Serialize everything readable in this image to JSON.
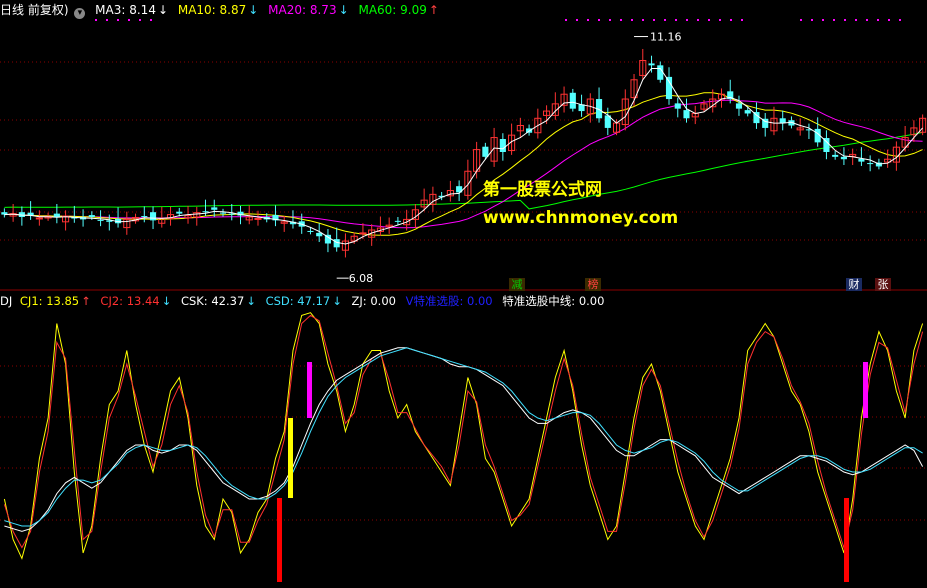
{
  "main_header": {
    "prefix": "日线 前复权)",
    "ma3": {
      "label": "MA3:",
      "value": "8.14",
      "arrow": "↓",
      "color": "#ffffff"
    },
    "ma10": {
      "label": "MA10:",
      "value": "8.87",
      "arrow": "↓",
      "color": "#ffff00"
    },
    "ma20": {
      "label": "MA20:",
      "value": "8.73",
      "arrow": "↓",
      "color": "#ff00ff"
    },
    "ma60": {
      "label": "MA60:",
      "value": "9.09",
      "arrow": "↑",
      "color": "#00ff00"
    }
  },
  "price_labels": {
    "high": "11.16",
    "low": "6.08"
  },
  "event_markers": [
    {
      "text": "减",
      "color": "#00cc00",
      "bg": "#3a2a00"
    },
    {
      "text": "榜",
      "color": "#ff4040",
      "bg": "#3a2a00"
    },
    {
      "text": "财",
      "color": "#ffffff",
      "bg": "#1a2a60"
    },
    {
      "text": "张",
      "color": "#ffffff",
      "bg": "#5a1010"
    }
  ],
  "watermark": {
    "line1": "第一股票公式网",
    "line2": "www.chnmoney.com"
  },
  "indicator_header": {
    "prefix": "DJ",
    "cj1": {
      "label": "CJ1:",
      "value": "13.85",
      "arrow": "↑",
      "color": "#ffff00"
    },
    "cj2": {
      "label": "CJ2:",
      "value": "13.44",
      "arrow": "↓",
      "color": "#ff3030"
    },
    "csk": {
      "label": "CSK:",
      "value": "42.37",
      "arrow": "↓",
      "color": "#ffffff"
    },
    "csd": {
      "label": "CSD:",
      "value": "47.17",
      "arrow": "↓",
      "color": "#40e0ff"
    },
    "zj": {
      "label": "ZJ:",
      "value": "0.00",
      "color": "#ffffff"
    },
    "v_select": {
      "label": "V特准选股:",
      "value": "0.00",
      "color": "#2020ff"
    },
    "mid_select": {
      "label": "特准选股中线:",
      "value": "0.00",
      "color": "#ffffff"
    }
  },
  "colors": {
    "background": "#000000",
    "grid": "#8b0000",
    "candle_up": "#ff3333",
    "candle_down": "#54ffff",
    "ma3": "#ffffff",
    "ma10": "#ffff00",
    "ma20": "#ff00ff",
    "ma60": "#00ff00",
    "cj1": "#ffff00",
    "cj2": "#ff3030",
    "csk": "#ffffff",
    "csd": "#40e0ff",
    "signal_red": "#ff0000",
    "signal_yellow": "#ffff00",
    "signal_magenta": "#ff00ff"
  },
  "chart_data": [
    {
      "type": "candlestick",
      "title": "日线 前复权",
      "price_range": [
        6.08,
        11.16
      ],
      "marked_high": 11.16,
      "marked_low": 6.08,
      "close_series": [
        7.4,
        7.42,
        7.35,
        7.38,
        7.33,
        7.36,
        7.34,
        7.37,
        7.32,
        7.3,
        7.35,
        7.28,
        7.25,
        7.22,
        7.3,
        7.34,
        7.36,
        7.28,
        7.32,
        7.4,
        7.42,
        7.38,
        7.44,
        7.46,
        7.5,
        7.42,
        7.4,
        7.38,
        7.35,
        7.32,
        7.3,
        7.28,
        7.25,
        7.2,
        7.15,
        7.05,
        6.95,
        6.8,
        6.72,
        6.85,
        6.95,
        7.02,
        7.08,
        7.12,
        7.18,
        7.25,
        7.3,
        7.5,
        7.7,
        7.82,
        7.76,
        7.9,
        7.86,
        8.3,
        8.75,
        8.6,
        9.0,
        8.7,
        9.05,
        9.25,
        9.1,
        9.4,
        9.55,
        9.7,
        9.9,
        9.6,
        9.55,
        9.8,
        9.4,
        9.2,
        9.3,
        9.8,
        10.2,
        10.6,
        10.5,
        10.2,
        9.8,
        9.6,
        9.4,
        9.5,
        9.7,
        9.8,
        9.9,
        9.8,
        9.6,
        9.5,
        9.3,
        9.2,
        9.4,
        9.3,
        9.25,
        9.2,
        9.15,
        8.9,
        8.7,
        8.6,
        8.55,
        8.65,
        8.5,
        8.45,
        8.4,
        8.55,
        8.8,
        9.0,
        9.2,
        9.4
      ],
      "ma_series": [
        {
          "name": "MA3",
          "last": 8.14
        },
        {
          "name": "MA10",
          "last": 8.87
        },
        {
          "name": "MA20",
          "last": 8.73
        },
        {
          "name": "MA60",
          "last": 9.09
        }
      ],
      "annotations": [
        "减",
        "榜",
        "财",
        "张"
      ]
    },
    {
      "type": "line",
      "title": "DJ",
      "ylim": [
        0,
        100
      ],
      "series": [
        {
          "name": "CJ1",
          "last": 13.85,
          "values": [
            30,
            15,
            8,
            20,
            45,
            60,
            95,
            80,
            40,
            10,
            20,
            45,
            65,
            70,
            85,
            65,
            50,
            40,
            55,
            70,
            75,
            60,
            35,
            20,
            15,
            30,
            25,
            10,
            15,
            25,
            30,
            45,
            55,
            85,
            98,
            99,
            95,
            80,
            70,
            55,
            65,
            80,
            85,
            85,
            70,
            60,
            65,
            55,
            50,
            45,
            40,
            35,
            55,
            75,
            65,
            45,
            40,
            30,
            20,
            25,
            30,
            45,
            60,
            75,
            85,
            70,
            50,
            35,
            25,
            15,
            20,
            40,
            60,
            75,
            80,
            70,
            55,
            40,
            30,
            20,
            15,
            25,
            35,
            45,
            60,
            85,
            90,
            95,
            90,
            80,
            70,
            65,
            55,
            40,
            30,
            20,
            10,
            30,
            60,
            80,
            92,
            85,
            70,
            60,
            85,
            95
          ]
        },
        {
          "name": "CJ2",
          "last": 13.44,
          "values": [
            28,
            18,
            12,
            18,
            40,
            55,
            88,
            82,
            48,
            15,
            18,
            40,
            60,
            68,
            80,
            68,
            55,
            42,
            50,
            65,
            72,
            62,
            40,
            24,
            16,
            26,
            26,
            14,
            14,
            22,
            28,
            40,
            52,
            80,
            95,
            98,
            96,
            84,
            72,
            58,
            62,
            76,
            82,
            84,
            74,
            62,
            62,
            56,
            50,
            46,
            42,
            36,
            50,
            70,
            66,
            50,
            42,
            32,
            22,
            24,
            28,
            42,
            56,
            70,
            82,
            72,
            54,
            38,
            28,
            18,
            18,
            36,
            56,
            72,
            78,
            72,
            58,
            44,
            32,
            22,
            16,
            22,
            32,
            42,
            56,
            80,
            88,
            92,
            90,
            82,
            72,
            66,
            58,
            44,
            32,
            22,
            12,
            26,
            54,
            76,
            88,
            86,
            74,
            62,
            80,
            92
          ]
        },
        {
          "name": "CSK",
          "last": 42.37,
          "values": [
            20,
            19,
            18,
            19,
            22,
            26,
            32,
            36,
            38,
            36,
            34,
            36,
            40,
            44,
            48,
            50,
            50,
            48,
            47,
            48,
            50,
            50,
            48,
            44,
            40,
            36,
            34,
            32,
            30,
            30,
            31,
            33,
            36,
            42,
            50,
            58,
            65,
            70,
            74,
            76,
            78,
            80,
            82,
            84,
            85,
            86,
            86,
            85,
            84,
            83,
            82,
            80,
            79,
            79,
            78,
            76,
            74,
            72,
            68,
            64,
            60,
            58,
            58,
            60,
            62,
            63,
            62,
            60,
            56,
            52,
            48,
            46,
            46,
            48,
            50,
            52,
            52,
            50,
            48,
            46,
            42,
            38,
            36,
            34,
            32,
            34,
            36,
            38,
            40,
            42,
            44,
            46,
            46,
            45,
            44,
            42,
            40,
            39,
            40,
            42,
            44,
            46,
            48,
            50,
            48,
            42
          ]
        },
        {
          "name": "CSD",
          "last": 47.17,
          "values": [
            22,
            21,
            20,
            20,
            22,
            25,
            30,
            34,
            37,
            37,
            36,
            37,
            40,
            43,
            47,
            49,
            50,
            49,
            48,
            48,
            49,
            50,
            49,
            46,
            42,
            38,
            35,
            33,
            31,
            30,
            30,
            32,
            35,
            40,
            47,
            55,
            62,
            68,
            72,
            75,
            77,
            79,
            81,
            83,
            84,
            85,
            86,
            85,
            84,
            83,
            82,
            81,
            80,
            79,
            78,
            77,
            75,
            73,
            70,
            66,
            62,
            60,
            59,
            60,
            61,
            62,
            62,
            61,
            58,
            54,
            50,
            48,
            47,
            48,
            49,
            51,
            52,
            51,
            49,
            47,
            44,
            40,
            37,
            35,
            33,
            33,
            35,
            37,
            39,
            41,
            43,
            45,
            46,
            46,
            45,
            43,
            41,
            40,
            40,
            41,
            43,
            45,
            47,
            49,
            49,
            47
          ]
        }
      ],
      "signals": [
        "red",
        "yellow",
        "magenta"
      ]
    }
  ]
}
